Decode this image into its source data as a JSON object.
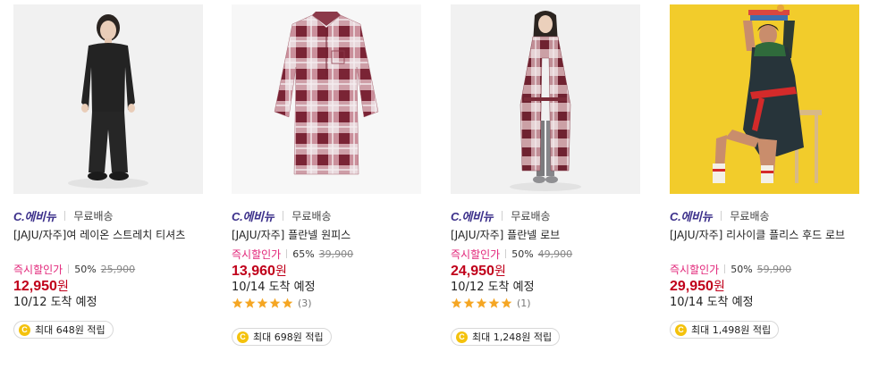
{
  "products": [
    {
      "brand": "C.에비뉴",
      "shipping": "무료배송",
      "title": "[JAJU/자주]여 레이온 스트레치 티셔츠",
      "discount_label": "즉시할인가",
      "discount_rate": "50%",
      "original_price": "25,900",
      "price": "12,950",
      "currency": "원",
      "delivery": "10/12 도착 예정",
      "reward_icon": "C",
      "reward": "최대 648원 적립",
      "image": "woman-black-loungewear"
    },
    {
      "brand": "C.에비뉴",
      "shipping": "무료배송",
      "title": "[JAJU/자주] 플란넬 원피스",
      "discount_label": "즉시할인가",
      "discount_rate": "65%",
      "original_price": "39,900",
      "price": "13,960",
      "currency": "원",
      "delivery": "10/14 도착 예정",
      "rating_stars": 5,
      "review_count": "(3)",
      "reward_icon": "C",
      "reward": "최대 698원 적립",
      "image": "plaid-flannel-dress"
    },
    {
      "brand": "C.에비뉴",
      "shipping": "무료배송",
      "title": "[JAJU/자주] 플란넬 로브",
      "discount_label": "즉시할인가",
      "discount_rate": "50%",
      "original_price": "49,900",
      "price": "24,950",
      "currency": "원",
      "delivery": "10/12 도착 예정",
      "rating_stars": 5,
      "review_count": "(1)",
      "reward_icon": "C",
      "reward": "최대 1,248원 적립",
      "image": "woman-plaid-robe"
    },
    {
      "brand": "C.에비뉴",
      "shipping": "무료배송",
      "title": "[JAJU/자주] 리사이클 플리스 후드 로브",
      "discount_label": "즉시할인가",
      "discount_rate": "50%",
      "original_price": "59,900",
      "price": "29,950",
      "currency": "원",
      "delivery": "10/14 도착 예정",
      "reward_icon": "C",
      "reward": "최대 1,498원 적립",
      "image": "woman-fleece-hood-robe-yellow"
    }
  ],
  "colors": {
    "brand": "#3b2f8a",
    "discount_label": "#e2267a",
    "price": "#c0001a",
    "star": "#f5a623",
    "coin": "#f4c20d",
    "yellow_bg": "#f2cc2b"
  }
}
